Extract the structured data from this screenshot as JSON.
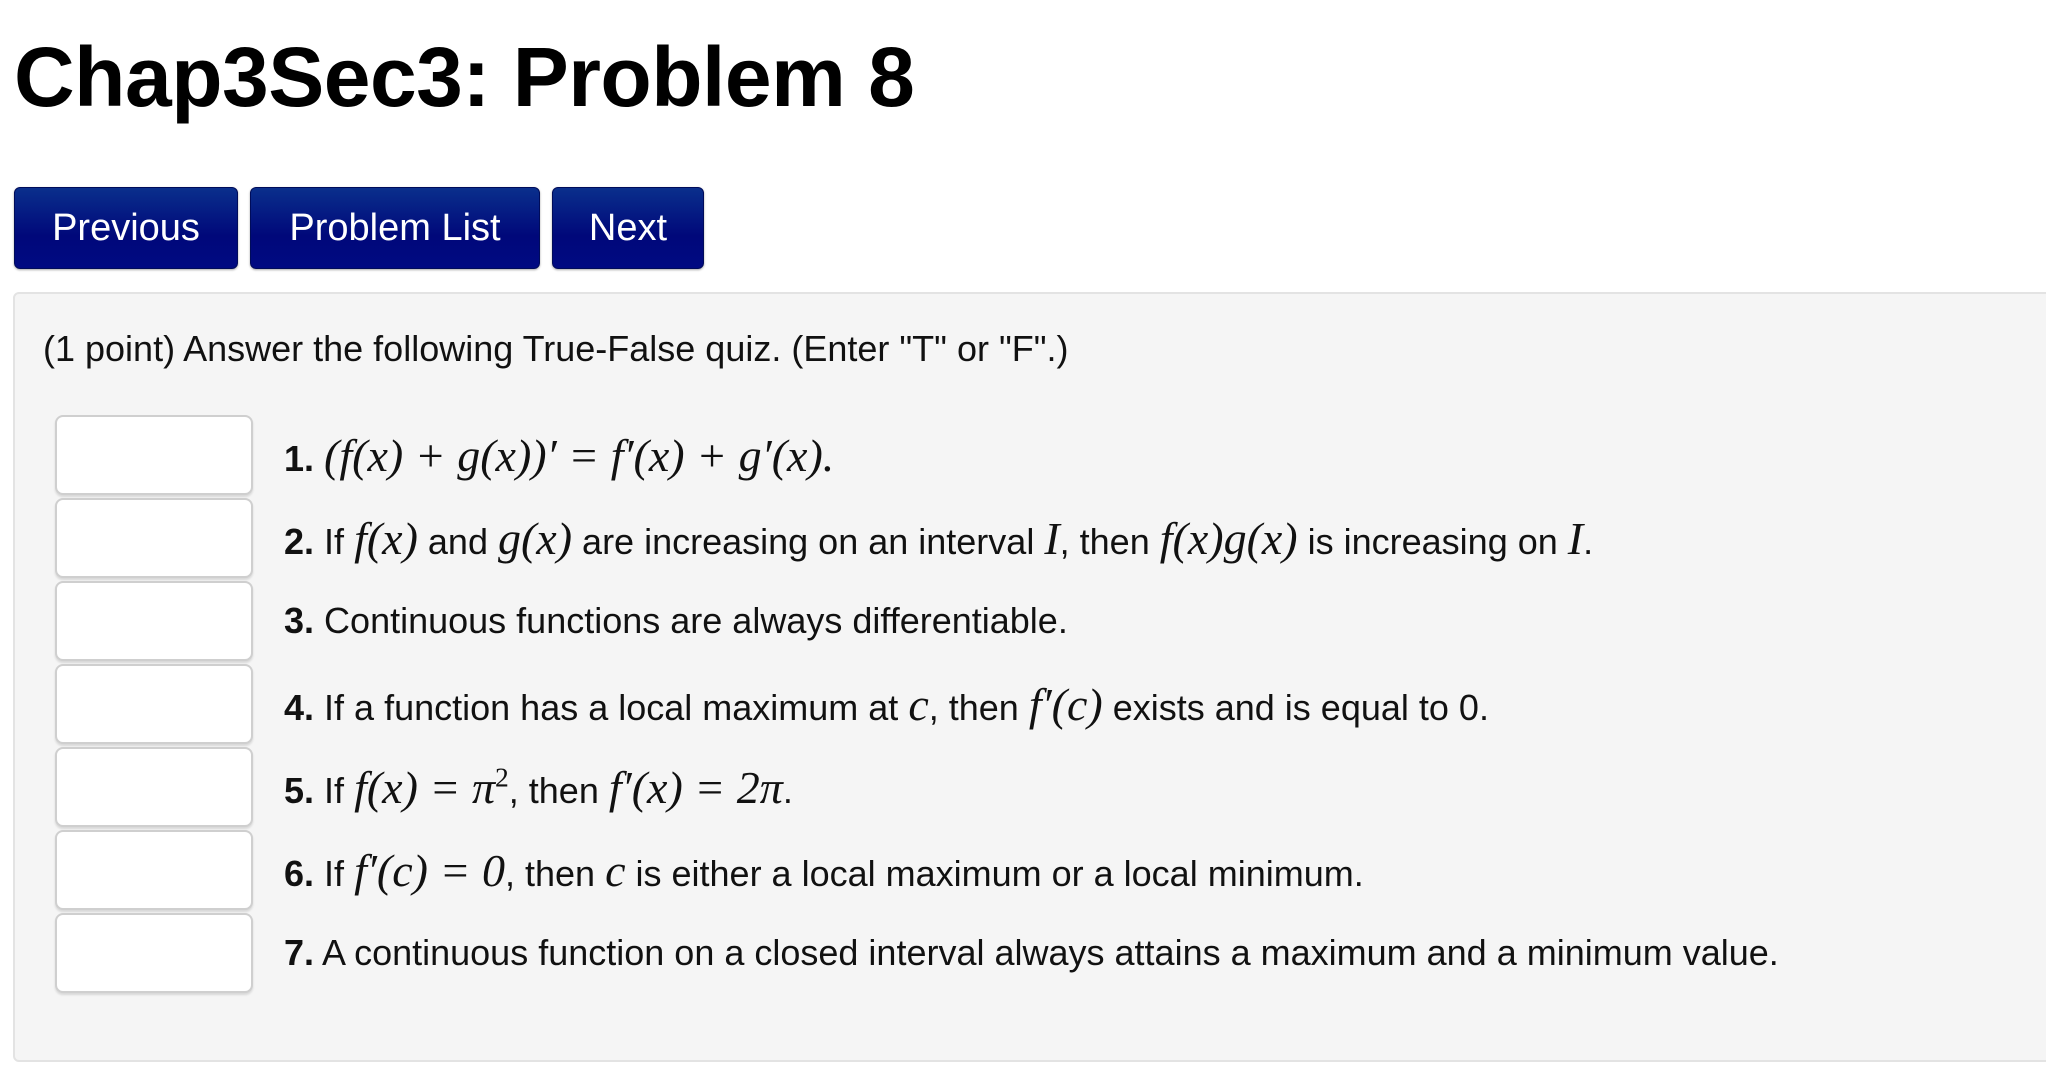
{
  "page": {
    "title": "Chap3Sec3: Problem 8"
  },
  "nav": {
    "previous_label": "Previous",
    "problem_list_label": "Problem List",
    "next_label": "Next"
  },
  "problem": {
    "intro": "(1 point) Answer the following True-False quiz. (Enter \"T\" or \"F\".)",
    "questions": [
      {
        "number": "1.",
        "answer": "",
        "parts": [
          "",
          "(f(x) + g(x))′ = f′(x) + g′(x).",
          ""
        ]
      },
      {
        "number": "2.",
        "answer": "",
        "parts": [
          "If ",
          "f(x)",
          " and ",
          "g(x)",
          " are increasing on an interval ",
          "I",
          ", then ",
          "f(x)g(x)",
          " is increasing on ",
          "I",
          "."
        ]
      },
      {
        "number": "3.",
        "answer": "",
        "parts": [
          "Continuous functions are always differentiable."
        ]
      },
      {
        "number": "4.",
        "answer": "",
        "parts": [
          "If a function has a local maximum at ",
          "c",
          ", then ",
          "f′(c)",
          " exists and is equal to 0."
        ]
      },
      {
        "number": "5.",
        "answer": "",
        "parts": [
          "If ",
          "f(x) = π",
          "2",
          ", then ",
          "f′(x) = 2π",
          "."
        ]
      },
      {
        "number": "6.",
        "answer": "",
        "parts": [
          "If ",
          "f′(c) = 0",
          ", then ",
          "c",
          " is either a local maximum or a local minimum."
        ]
      },
      {
        "number": "7.",
        "answer": "",
        "parts": [
          "A continuous function on a closed interval always attains a maximum and a minimum value."
        ]
      }
    ]
  }
}
